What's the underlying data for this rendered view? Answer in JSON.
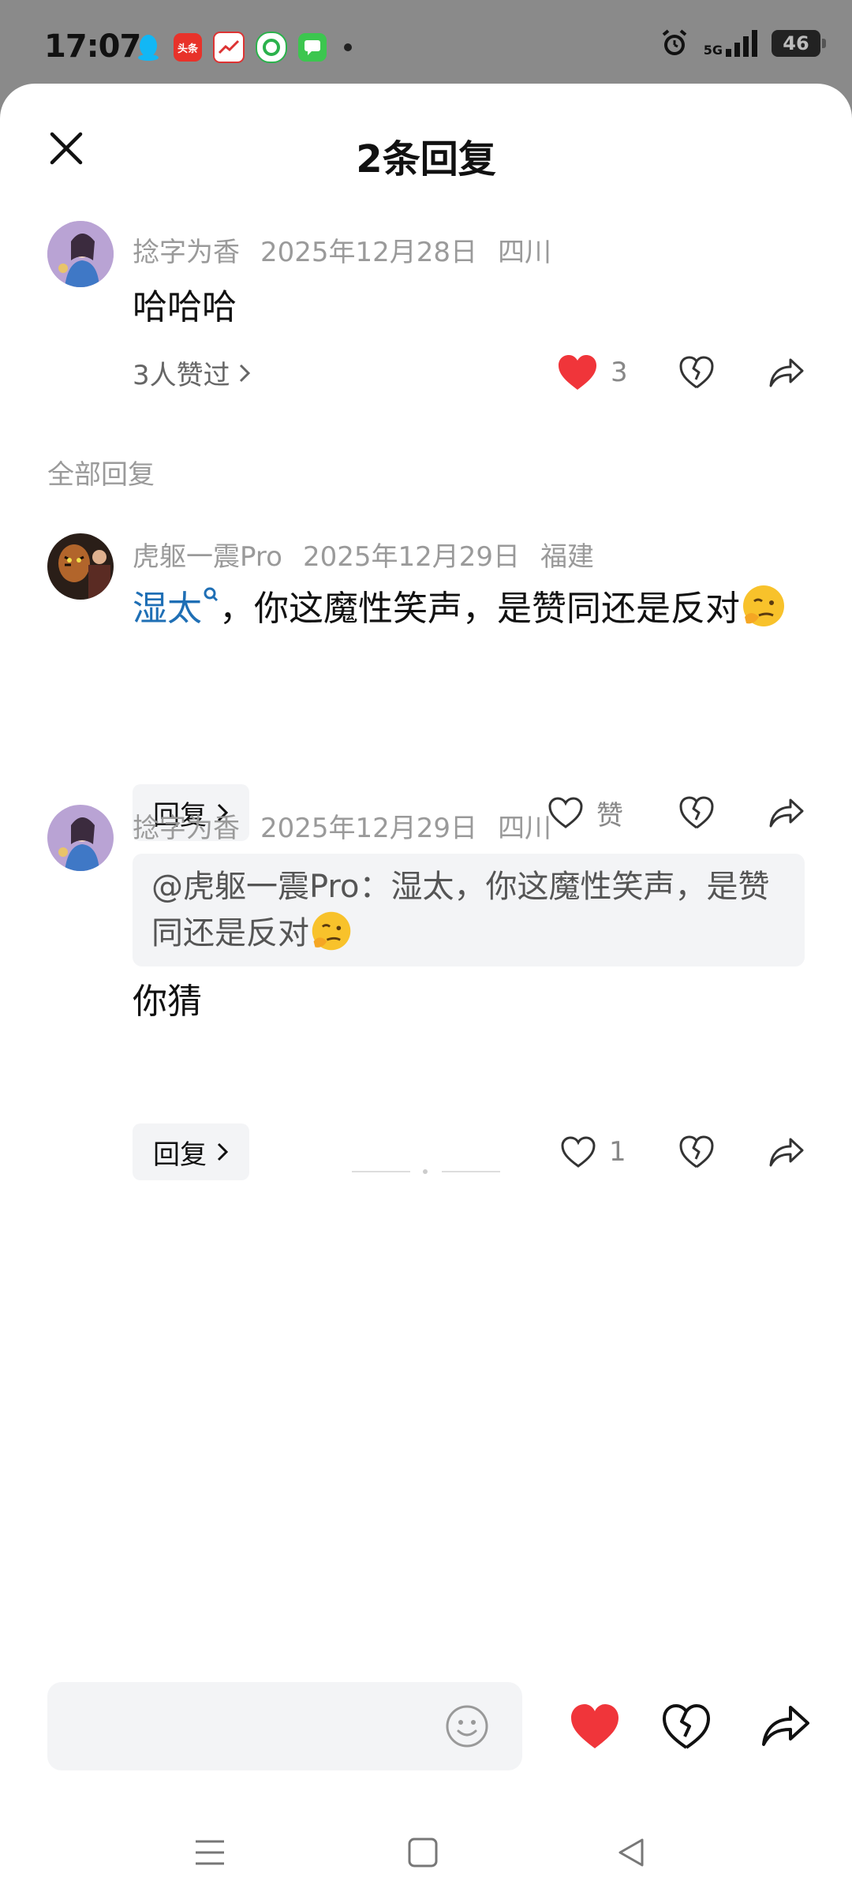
{
  "status_bar": {
    "time": "17:07",
    "network": "5G",
    "battery": "46",
    "app_icons": [
      "qq-icon",
      "toutiao-icon",
      "stocks-icon",
      "app-360-icon",
      "messages-icon"
    ],
    "toutiao_label": "头条"
  },
  "sheet": {
    "title": "2条回复",
    "section_label": "全部回复"
  },
  "main_comment": {
    "author": "捻字为香",
    "date": "2025年12月28日",
    "location": "四川",
    "text": "哈哈哈",
    "likers_label": "3人赞过",
    "like_count": "3",
    "liked": true
  },
  "replies": [
    {
      "author": "虎躯一震Pro",
      "date": "2025年12月29日",
      "location": "福建",
      "mention": "湿太",
      "text": "，你这魔性笑声，是赞同还是反对",
      "reply_label": "回复",
      "like_label": "赞"
    },
    {
      "author": "捻字为香",
      "date": "2025年12月29日",
      "location": "四川",
      "quote": "@虎躯一震Pro：湿太，你这魔性笑声，是赞同还是反对",
      "text": "你猜",
      "reply_label": "回复",
      "like_count": "1"
    }
  ],
  "colors": {
    "like_red": "#f0353a",
    "mention_blue": "#1f6fb5",
    "status_bar_bg": "#8a8a8a"
  }
}
